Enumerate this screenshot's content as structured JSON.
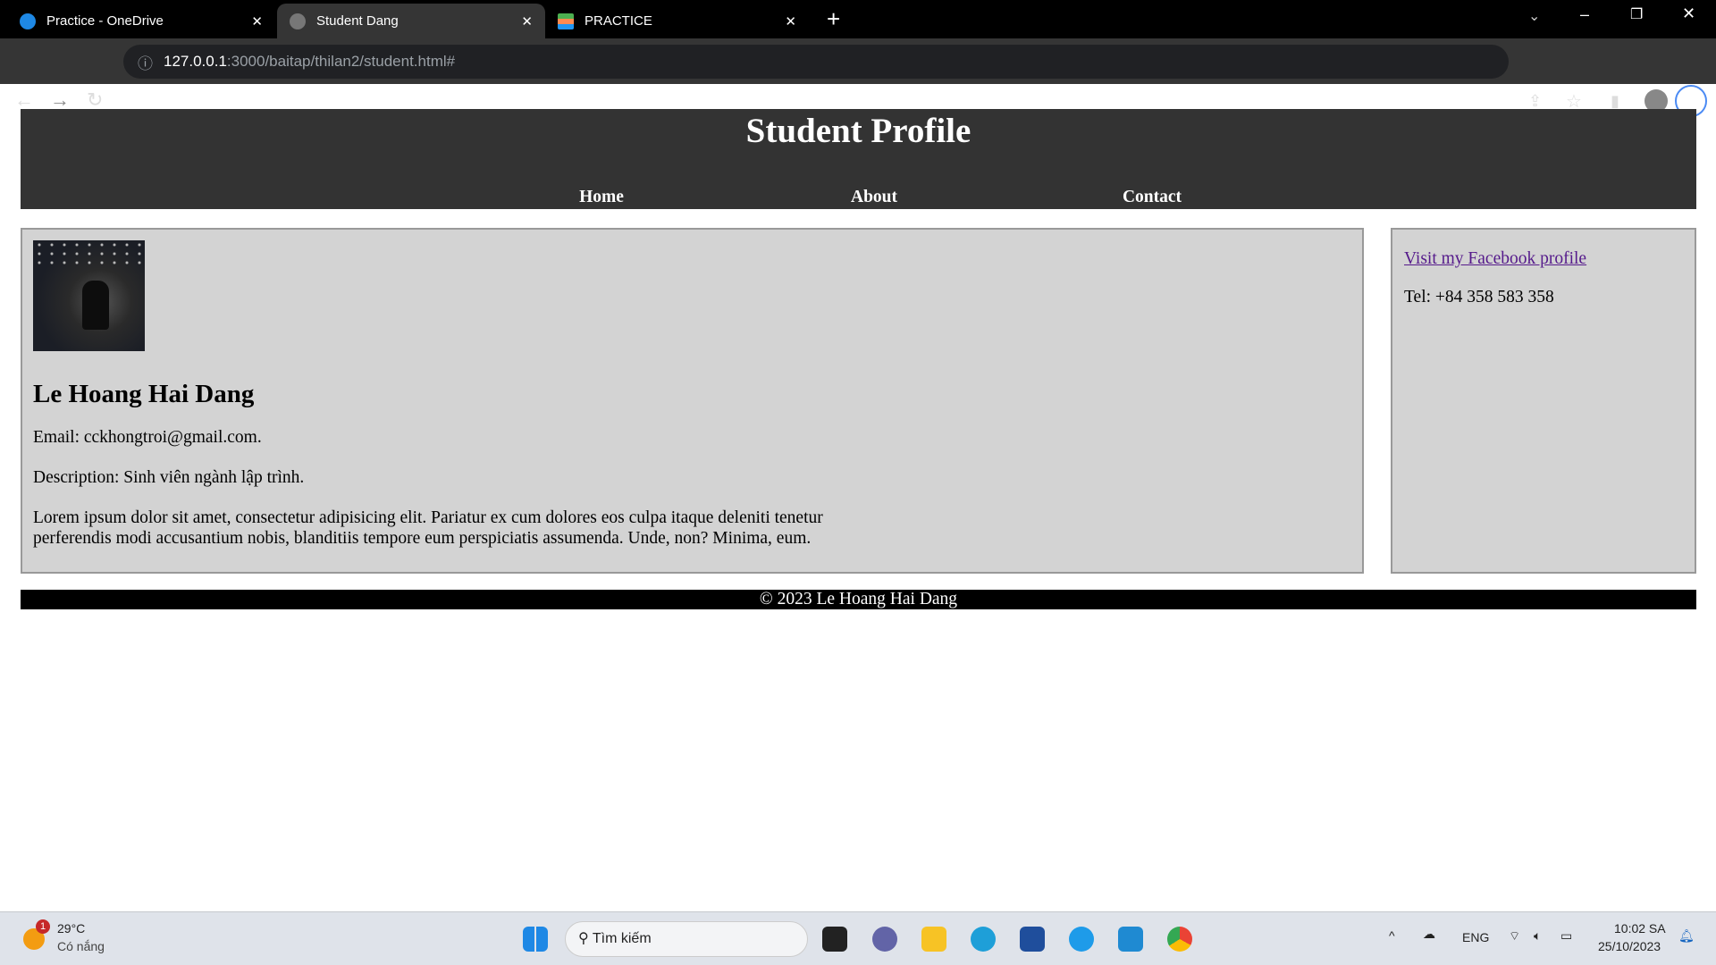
{
  "browser": {
    "tabs": [
      {
        "label": "Practice - OneDrive",
        "active": false
      },
      {
        "label": "Student Dang",
        "active": true
      },
      {
        "label": "PRACTICE",
        "active": false
      }
    ],
    "url_host": "127.0.0.1",
    "url_rest": ":3000/baitap/thilan2/student.html#"
  },
  "header": {
    "title": "Student Profile",
    "nav": [
      "Home",
      "About",
      "Contact"
    ]
  },
  "main": {
    "name": "Le Hoang Hai Dang",
    "email": "Email: cckhongtroi@gmail.com.",
    "description": "Description: Sinh viên ngành lập trình.",
    "lorem": "Lorem ipsum dolor sit amet, consectetur adipisicing elit. Pariatur ex cum dolores eos culpa itaque deleniti tenetur perferendis modi accusantium nobis, blanditiis tempore eum perspiciatis assumenda. Unde, non? Minima, eum."
  },
  "sidebar": {
    "link": "Visit my Facebook profile",
    "tel": "Tel: +84 358 583 358"
  },
  "footer": {
    "text": "© 2023 Le Hoang Hai Dang"
  },
  "taskbar": {
    "temp": "29°C",
    "weather": "Có nắng",
    "badge": "1",
    "search": "Tìm kiếm",
    "lang": "ENG",
    "time": "10:02 SA",
    "date": "25/10/2023"
  }
}
